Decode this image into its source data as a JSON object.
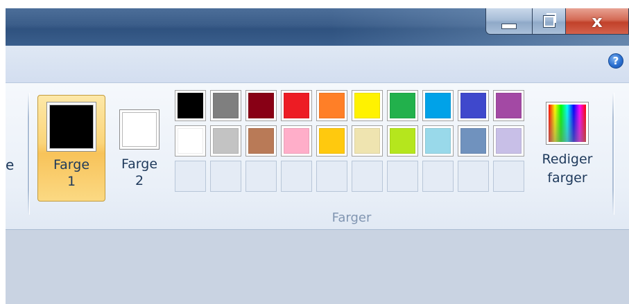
{
  "window": {
    "caption_buttons": {
      "minimize_icon": "minimize-icon",
      "maximize_icon": "restore-icon",
      "close_label": "x"
    },
    "help_label": "?"
  },
  "ribbon": {
    "partial_label": "e",
    "color1": {
      "label_line1": "Farge",
      "label_line2": "1",
      "value": "#000000",
      "selected": true
    },
    "color2": {
      "label_line1": "Farge",
      "label_line2": "2",
      "value": "#ffffff"
    },
    "palette": {
      "rows": [
        [
          "#000000",
          "#7f7f7f",
          "#880015",
          "#ed1c24",
          "#ff7f27",
          "#fff200",
          "#22b14c",
          "#00a2e8",
          "#3f48cc",
          "#a349a4"
        ],
        [
          "#ffffff",
          "#c3c3c3",
          "#b97a57",
          "#ffaec9",
          "#ffc90e",
          "#efe4b0",
          "#b5e61d",
          "#99d9ea",
          "#7092be",
          "#c8bfe7"
        ],
        [
          null,
          null,
          null,
          null,
          null,
          null,
          null,
          null,
          null,
          null
        ]
      ]
    },
    "edit_colors": {
      "label_line1": "Rediger",
      "label_line2": "farger"
    },
    "group_label": "Farger"
  }
}
